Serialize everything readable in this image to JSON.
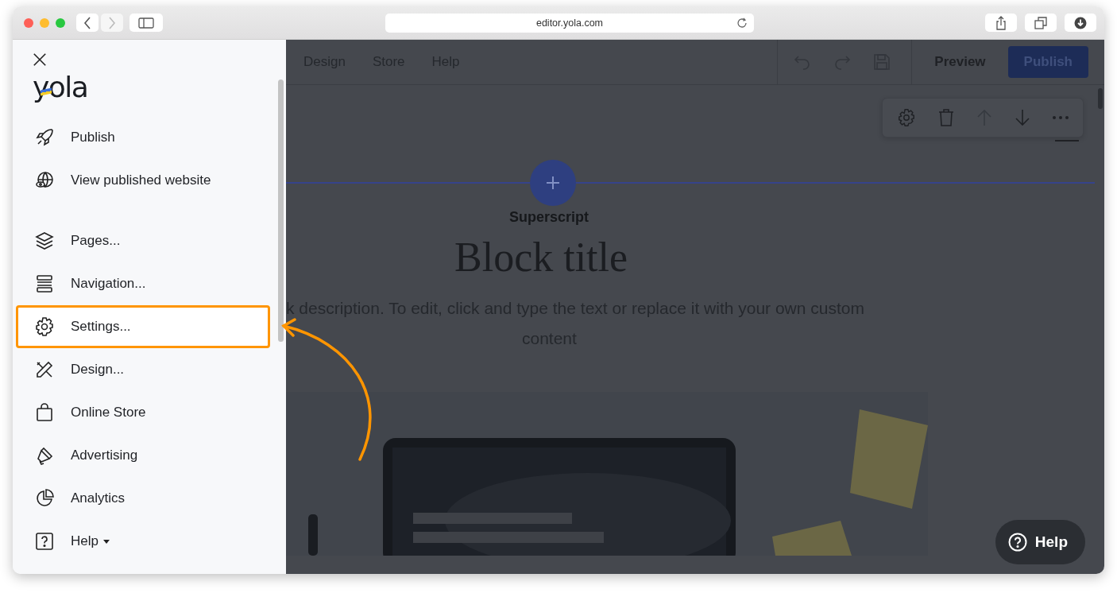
{
  "browser": {
    "url": "editor.yola.com"
  },
  "sidebar": {
    "logo": "yola",
    "groups": [
      [
        {
          "label": "Publish",
          "highlighted": false,
          "has_menu": false
        },
        {
          "label": "View published website",
          "highlighted": false,
          "has_menu": false
        }
      ],
      [
        {
          "label": "Pages...",
          "highlighted": false,
          "has_menu": false
        },
        {
          "label": "Navigation...",
          "highlighted": false,
          "has_menu": false
        },
        {
          "label": "Settings...",
          "highlighted": true,
          "has_menu": false
        },
        {
          "label": "Design...",
          "highlighted": false,
          "has_menu": false
        },
        {
          "label": "Online Store",
          "highlighted": false,
          "has_menu": false
        },
        {
          "label": "Advertising",
          "highlighted": false,
          "has_menu": false
        },
        {
          "label": "Analytics",
          "highlighted": false,
          "has_menu": false
        },
        {
          "label": "Help",
          "highlighted": false,
          "has_menu": true
        }
      ]
    ]
  },
  "editor": {
    "menu": [
      "Design",
      "Store",
      "Help"
    ],
    "preview_button": "Preview",
    "publish_button": "Publish",
    "block": {
      "superscript": "Superscript",
      "title": "Block title",
      "description_lines": [
        "k description. To edit, click and type the text or replace it with your own custom",
        "content"
      ],
      "image": {
        "kind": "picture"
      }
    },
    "help_button": "Help"
  }
}
